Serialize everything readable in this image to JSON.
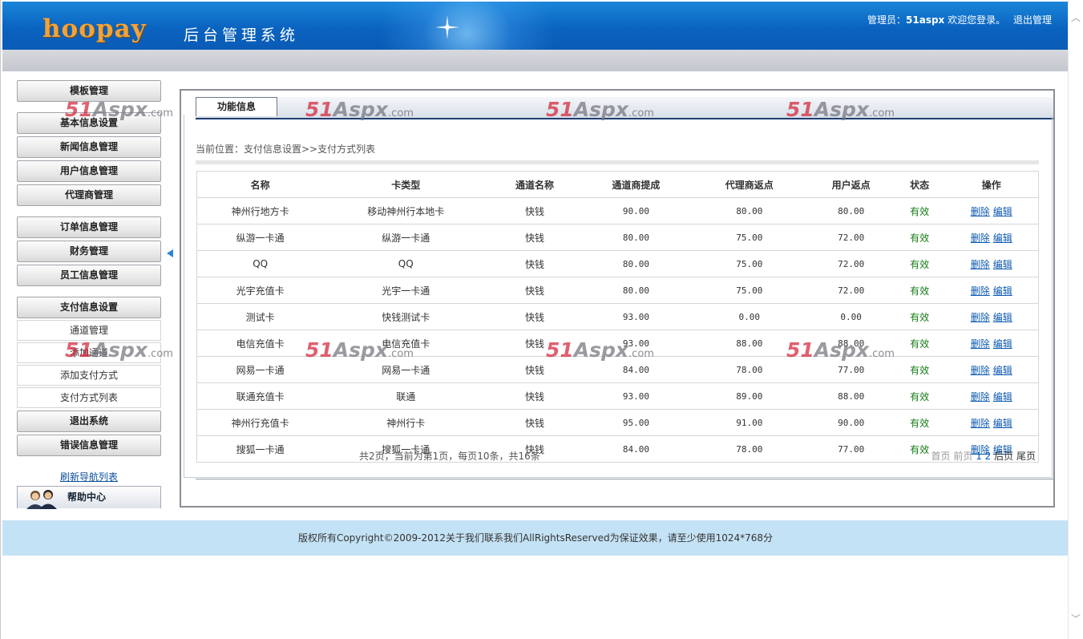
{
  "header": {
    "logo": "hoopay",
    "system_name": "后台管理系统",
    "admin_label": "管理员：",
    "admin_name": "51aspx",
    "welcome": "欢迎您登录。",
    "logout": "退出管理"
  },
  "sidebar": {
    "menus": [
      "模板管理",
      "基本信息设置",
      "新闻信息管理",
      "用户信息管理",
      "代理商管理",
      "订单信息管理",
      "财务管理",
      "员工信息管理",
      "支付信息设置"
    ],
    "sub_items": [
      "通道管理",
      "添加通道",
      "添加支付方式",
      "支付方式列表"
    ],
    "menus_after": [
      "退出系统",
      "错误信息管理"
    ],
    "refresh": "刷新导航列表",
    "help": "帮助中心"
  },
  "main": {
    "tab": "功能信息",
    "breadcrumb": "当前位置：支付信息设置>>支付方式列表",
    "table": {
      "headers": [
        "名称",
        "卡类型",
        "通道名称",
        "通道商提成",
        "代理商返点",
        "用户返点",
        "状态",
        "操作"
      ],
      "rows": [
        [
          "神州行地方卡",
          "移动神州行本地卡",
          "快钱",
          "90.00",
          "80.00",
          "80.00",
          "有效"
        ],
        [
          "纵游一卡通",
          "纵游一卡通",
          "快钱",
          "80.00",
          "75.00",
          "72.00",
          "有效"
        ],
        [
          "QQ",
          "QQ",
          "快钱",
          "80.00",
          "75.00",
          "72.00",
          "有效"
        ],
        [
          "光宇充值卡",
          "光宇一卡通",
          "快钱",
          "80.00",
          "75.00",
          "72.00",
          "有效"
        ],
        [
          "测试卡",
          "快钱测试卡",
          "快钱",
          "93.00",
          "0.00",
          "0.00",
          "有效"
        ],
        [
          "电信充值卡",
          "电信充值卡",
          "快钱",
          "93.00",
          "88.00",
          "88.00",
          "有效"
        ],
        [
          "网易一卡通",
          "网易一卡通",
          "快钱",
          "84.00",
          "78.00",
          "77.00",
          "有效"
        ],
        [
          "联通充值卡",
          "联通",
          "快钱",
          "93.00",
          "89.00",
          "88.00",
          "有效"
        ],
        [
          "神州行充值卡",
          "神州行卡",
          "快钱",
          "95.00",
          "91.00",
          "90.00",
          "有效"
        ],
        [
          "搜狐一卡通",
          "搜狐一卡通",
          "快钱",
          "84.00",
          "78.00",
          "77.00",
          "有效"
        ]
      ],
      "action_delete": "删除",
      "action_edit": "编辑"
    },
    "pager": {
      "summary": "共2页，当前为第1页，每页10条，共16条",
      "first": "首页",
      "prev": "前页",
      "page1": "1",
      "page2": "2",
      "next": "后页",
      "last": "尾页"
    }
  },
  "footer": {
    "text": "版权所有Copyright©2009-2012关于我们联系我们AllRightsReserved为保证效果，请至少使用1024*768分"
  },
  "watermark": {
    "brand": "51",
    "word": "Aspx",
    "domain": ".com"
  }
}
